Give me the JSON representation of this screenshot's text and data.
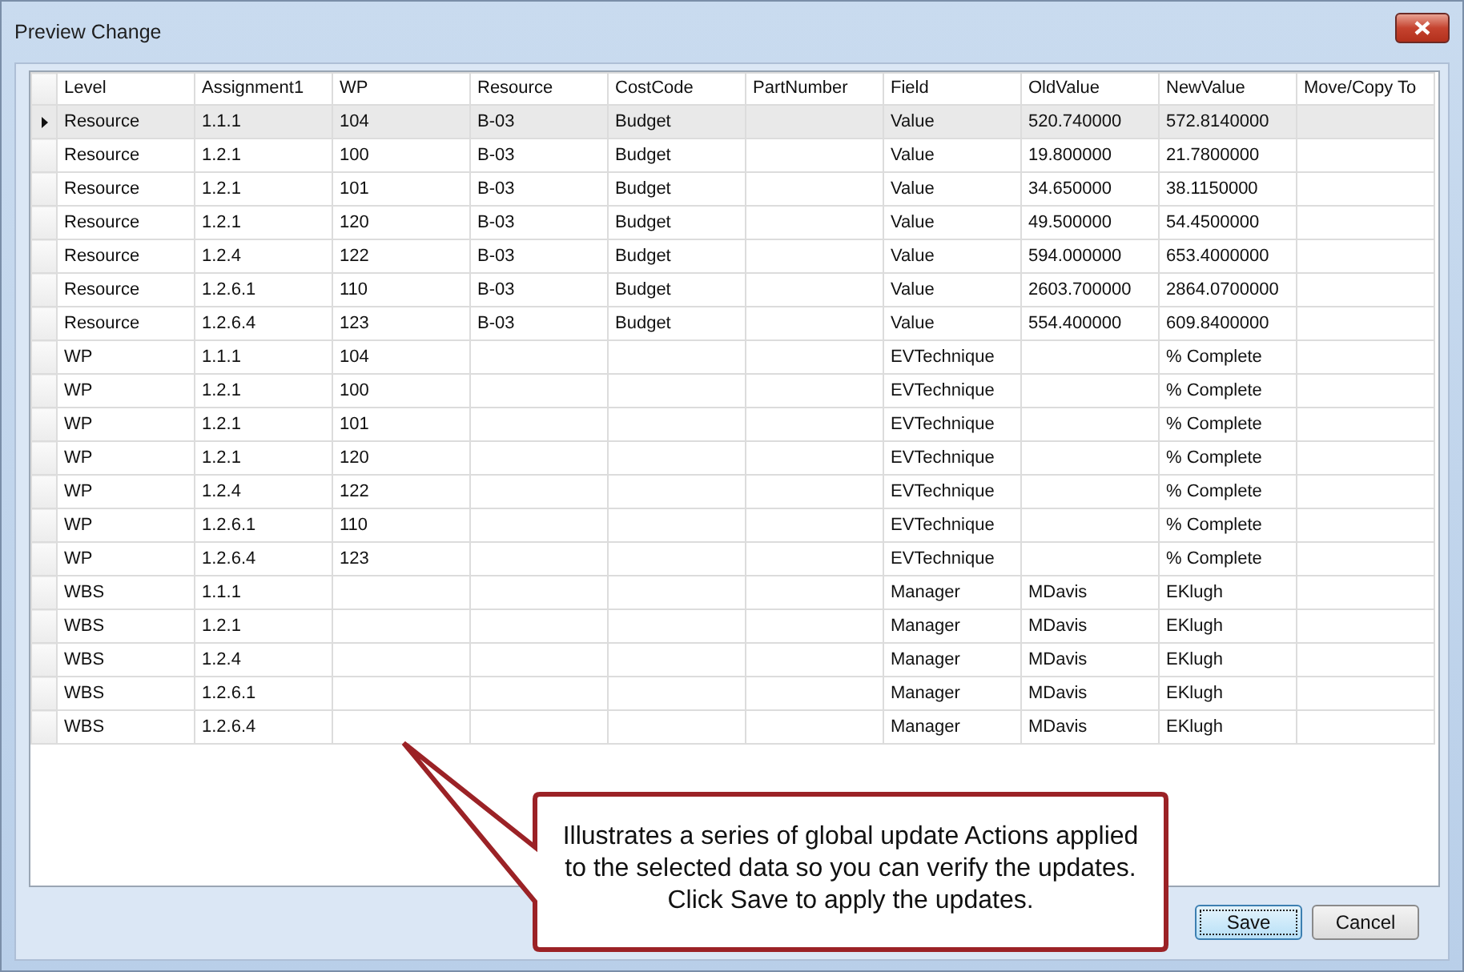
{
  "window": {
    "title": "Preview Change"
  },
  "table": {
    "columns": [
      "Level",
      "Assignment1",
      "WP",
      "Resource",
      "CostCode",
      "PartNumber",
      "Field",
      "OldValue",
      "NewValue",
      "Move/Copy To"
    ],
    "rows": [
      {
        "selected": true,
        "cells": [
          "Resource",
          "1.1.1",
          "104",
          "B-03",
          "Budget",
          "",
          "Value",
          "520.740000",
          "572.8140000",
          ""
        ]
      },
      {
        "selected": false,
        "cells": [
          "Resource",
          "1.2.1",
          "100",
          "B-03",
          "Budget",
          "",
          "Value",
          "19.800000",
          "21.7800000",
          ""
        ]
      },
      {
        "selected": false,
        "cells": [
          "Resource",
          "1.2.1",
          "101",
          "B-03",
          "Budget",
          "",
          "Value",
          "34.650000",
          "38.1150000",
          ""
        ]
      },
      {
        "selected": false,
        "cells": [
          "Resource",
          "1.2.1",
          "120",
          "B-03",
          "Budget",
          "",
          "Value",
          "49.500000",
          "54.4500000",
          ""
        ]
      },
      {
        "selected": false,
        "cells": [
          "Resource",
          "1.2.4",
          "122",
          "B-03",
          "Budget",
          "",
          "Value",
          "594.000000",
          "653.4000000",
          ""
        ]
      },
      {
        "selected": false,
        "cells": [
          "Resource",
          "1.2.6.1",
          "110",
          "B-03",
          "Budget",
          "",
          "Value",
          "2603.700000",
          "2864.0700000",
          ""
        ]
      },
      {
        "selected": false,
        "cells": [
          "Resource",
          "1.2.6.4",
          "123",
          "B-03",
          "Budget",
          "",
          "Value",
          "554.400000",
          "609.8400000",
          ""
        ]
      },
      {
        "selected": false,
        "cells": [
          "WP",
          "1.1.1",
          "104",
          "",
          "",
          "",
          "EVTechnique",
          "",
          "% Complete",
          ""
        ]
      },
      {
        "selected": false,
        "cells": [
          "WP",
          "1.2.1",
          "100",
          "",
          "",
          "",
          "EVTechnique",
          "",
          "% Complete",
          ""
        ]
      },
      {
        "selected": false,
        "cells": [
          "WP",
          "1.2.1",
          "101",
          "",
          "",
          "",
          "EVTechnique",
          "",
          "% Complete",
          ""
        ]
      },
      {
        "selected": false,
        "cells": [
          "WP",
          "1.2.1",
          "120",
          "",
          "",
          "",
          "EVTechnique",
          "",
          "% Complete",
          ""
        ]
      },
      {
        "selected": false,
        "cells": [
          "WP",
          "1.2.4",
          "122",
          "",
          "",
          "",
          "EVTechnique",
          "",
          "% Complete",
          ""
        ]
      },
      {
        "selected": false,
        "cells": [
          "WP",
          "1.2.6.1",
          "110",
          "",
          "",
          "",
          "EVTechnique",
          "",
          "% Complete",
          ""
        ]
      },
      {
        "selected": false,
        "cells": [
          "WP",
          "1.2.6.4",
          "123",
          "",
          "",
          "",
          "EVTechnique",
          "",
          "% Complete",
          ""
        ]
      },
      {
        "selected": false,
        "cells": [
          "WBS",
          "1.1.1",
          "",
          "",
          "",
          "",
          "Manager",
          "MDavis",
          "EKlugh",
          ""
        ]
      },
      {
        "selected": false,
        "cells": [
          "WBS",
          "1.2.1",
          "",
          "",
          "",
          "",
          "Manager",
          "MDavis",
          "EKlugh",
          ""
        ]
      },
      {
        "selected": false,
        "cells": [
          "WBS",
          "1.2.4",
          "",
          "",
          "",
          "",
          "Manager",
          "MDavis",
          "EKlugh",
          ""
        ]
      },
      {
        "selected": false,
        "cells": [
          "WBS",
          "1.2.6.1",
          "",
          "",
          "",
          "",
          "Manager",
          "MDavis",
          "EKlugh",
          ""
        ]
      },
      {
        "selected": false,
        "cells": [
          "WBS",
          "1.2.6.4",
          "",
          "",
          "",
          "",
          "Manager",
          "MDavis",
          "EKlugh",
          ""
        ]
      }
    ]
  },
  "callout": {
    "text": "Illustrates a series of global update Actions applied to the selected data so you can verify the updates. Click Save to apply the updates."
  },
  "buttons": [
    {
      "label": "Save",
      "default": true
    },
    {
      "label": "Cancel",
      "default": false
    }
  ]
}
